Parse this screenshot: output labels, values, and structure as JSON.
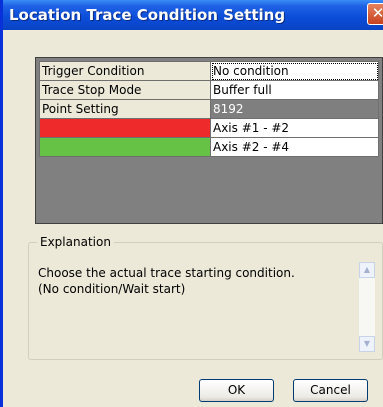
{
  "window": {
    "title": "Location Trace Condition Setting",
    "close_glyph": "✕"
  },
  "settings": [
    {
      "label": "Trigger Condition",
      "value": "No condition"
    },
    {
      "label": "Trace Stop Mode",
      "value": "Buffer full"
    },
    {
      "label": "Point Setting",
      "value": "8192"
    },
    {
      "label": "",
      "value": "Axis #1 - #2",
      "swatch_color": "#ef2a2a"
    },
    {
      "label": "",
      "value": "Axis #2 - #4",
      "swatch_color": "#66c244"
    }
  ],
  "explanation": {
    "title": "Explanation",
    "text": "Choose the actual trace starting condition.\n(No condition/Wait start)"
  },
  "buttons": {
    "ok": "OK",
    "cancel": "Cancel"
  }
}
